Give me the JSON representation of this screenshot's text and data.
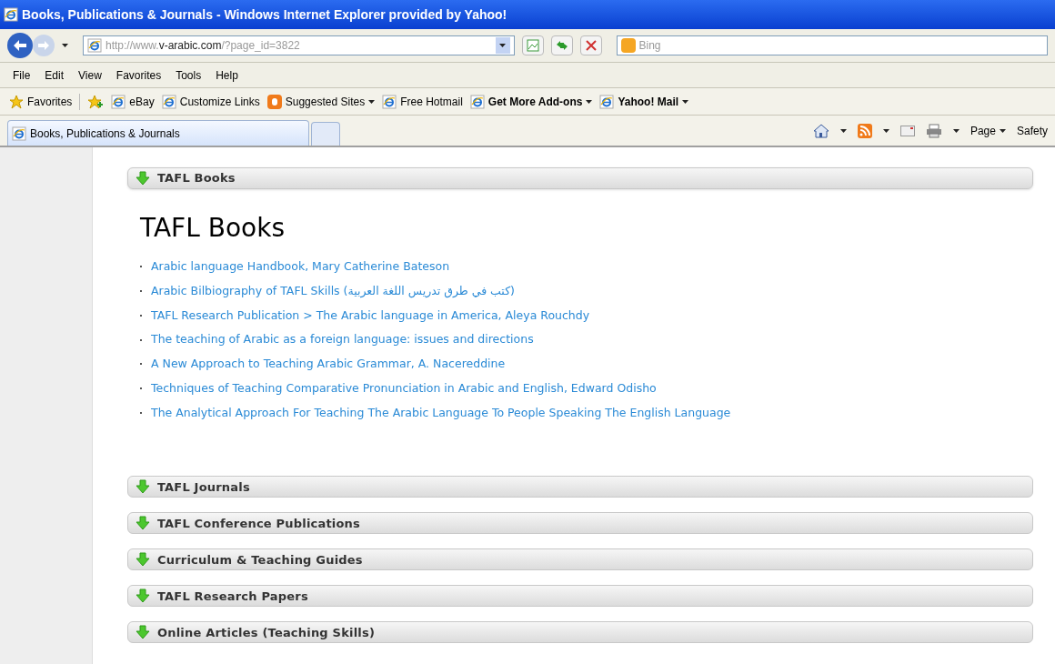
{
  "window": {
    "title": "Books, Publications & Journals - Windows Internet Explorer provided by Yahoo!"
  },
  "address_bar": {
    "url_prefix": "http://www.",
    "url_domain": "v-arabic.com",
    "url_suffix": "/?page_id=3822"
  },
  "search": {
    "placeholder": "Bing"
  },
  "menu": [
    "File",
    "Edit",
    "View",
    "Favorites",
    "Tools",
    "Help"
  ],
  "favorites_bar": {
    "label": "Favorites",
    "items": [
      {
        "label": "eBay",
        "kind": "ie",
        "bold": false,
        "dropdown": false
      },
      {
        "label": "Customize Links",
        "kind": "ie",
        "bold": false,
        "dropdown": false
      },
      {
        "label": "Suggested Sites",
        "kind": "suggested",
        "bold": false,
        "dropdown": true
      },
      {
        "label": "Free Hotmail",
        "kind": "ie",
        "bold": false,
        "dropdown": false
      },
      {
        "label": "Get More Add-ons",
        "kind": "ie",
        "bold": true,
        "dropdown": true
      },
      {
        "label": "Yahoo! Mail",
        "kind": "ie",
        "bold": true,
        "dropdown": true
      }
    ]
  },
  "tabs": [
    {
      "label": "Books, Publications & Journals",
      "selected": true
    }
  ],
  "command_bar": [
    "Page",
    "Safety"
  ],
  "sections": [
    {
      "title": "TAFL Books",
      "expanded": true,
      "heading": "TAFL Books",
      "links": [
        "Arabic language Handbook, Mary Catherine Bateson",
        "Arabic Bilbiography of TAFL Skills (كتب في طرق تدريس اللغة العربية)",
        "TAFL Research Publication > The Arabic language in America, Aleya Rouchdy",
        "The teaching of Arabic as a foreign language: issues and directions",
        "A New Approach to Teaching Arabic Grammar, A. Nacereddine",
        "Techniques of Teaching Comparative Pronunciation in Arabic and English, Edward Odisho",
        "The Analytical Approach For Teaching The Arabic Language To People Speaking The English Language"
      ]
    },
    {
      "title": "TAFL Journals",
      "expanded": false
    },
    {
      "title": "TAFL Conference Publications",
      "expanded": false
    },
    {
      "title": "Curriculum & Teaching Guides",
      "expanded": false
    },
    {
      "title": "TAFL Research Papers",
      "expanded": false
    },
    {
      "title": "Online Articles (Teaching Skills)",
      "expanded": false
    }
  ]
}
